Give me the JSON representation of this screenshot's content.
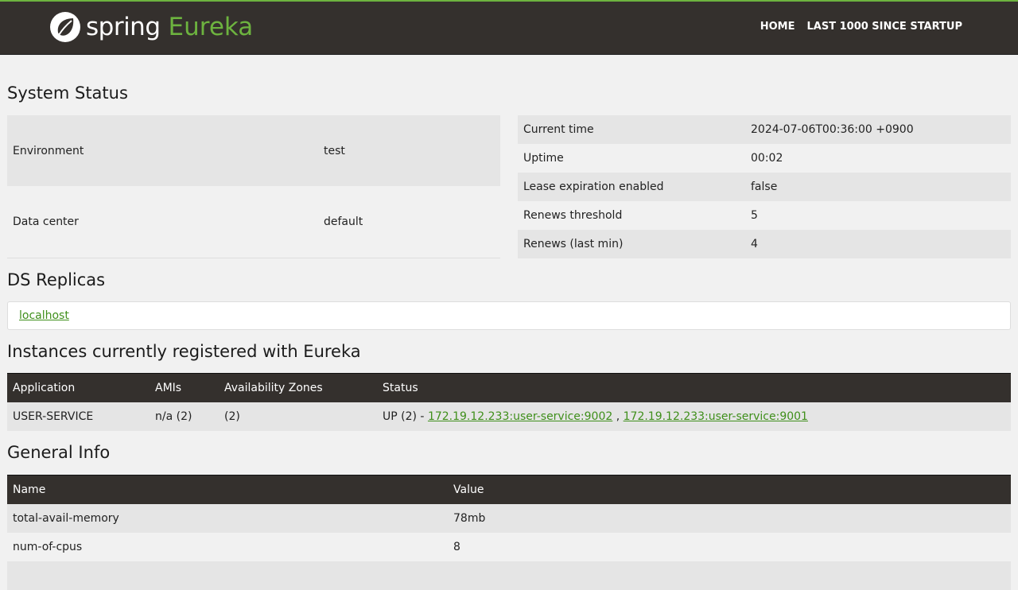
{
  "header": {
    "brand_spring": "spring",
    "brand_eureka": "Eureka",
    "nav": [
      "HOME",
      "LAST 1000 SINCE STARTUP"
    ]
  },
  "system_status": {
    "title": "System Status",
    "left": [
      {
        "label": "Environment",
        "value": "test"
      },
      {
        "label": "Data center",
        "value": "default"
      }
    ],
    "right": [
      {
        "label": "Current time",
        "value": "2024-07-06T00:36:00 +0900"
      },
      {
        "label": "Uptime",
        "value": "00:02"
      },
      {
        "label": "Lease expiration enabled",
        "value": "false"
      },
      {
        "label": "Renews threshold",
        "value": "5"
      },
      {
        "label": "Renews (last min)",
        "value": "4"
      }
    ]
  },
  "ds_replicas": {
    "title": "DS Replicas",
    "items": [
      "localhost"
    ]
  },
  "instances": {
    "title": "Instances currently registered with Eureka",
    "columns": [
      "Application",
      "AMIs",
      "Availability Zones",
      "Status"
    ],
    "rows": [
      {
        "application": "USER-SERVICE",
        "amis": "n/a (2)",
        "zones": "(2)",
        "status_prefix": "UP (2) - ",
        "links": [
          "172.19.12.233:user-service:9002",
          "172.19.12.233:user-service:9001"
        ],
        "link_sep": " , "
      }
    ]
  },
  "general_info": {
    "title": "General Info",
    "columns": [
      "Name",
      "Value"
    ],
    "rows": [
      {
        "name": "total-avail-memory",
        "value": "78mb"
      },
      {
        "name": "num-of-cpus",
        "value": "8"
      }
    ]
  },
  "colors": {
    "header_bg": "#34302d",
    "brand_green": "#6db33f",
    "link_green": "#3f8f1b",
    "page_bg": "#f1f1f1"
  }
}
